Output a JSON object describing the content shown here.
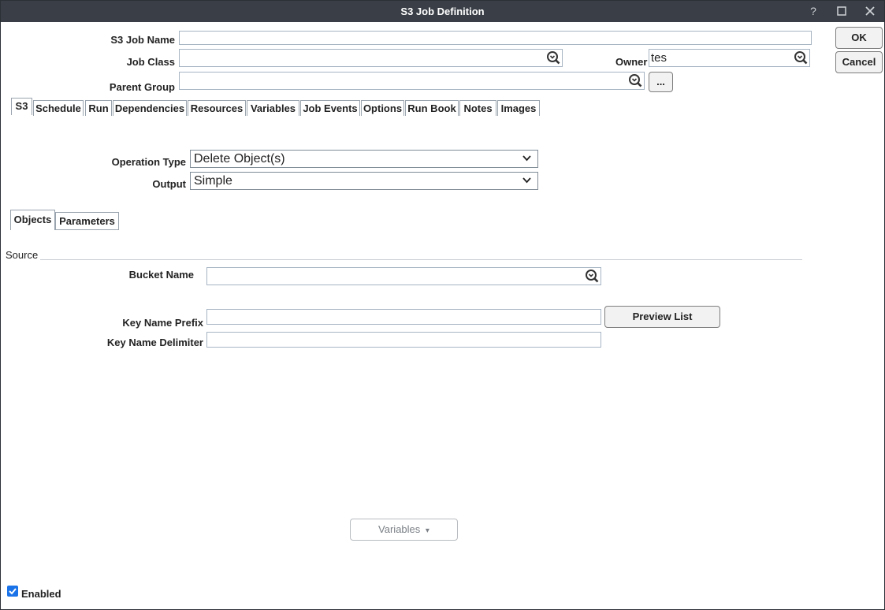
{
  "window": {
    "title": "S3 Job Definition",
    "help_label": "?"
  },
  "header": {
    "job_name_label": "S3 Job Name",
    "job_name_value": "",
    "job_class_label": "Job Class",
    "job_class_value": "",
    "owner_label": "Owner",
    "owner_value": "tes",
    "parent_group_label": "Parent Group",
    "parent_group_value": "",
    "browse_label": "..."
  },
  "actions": {
    "ok_label": "OK",
    "cancel_label": "Cancel"
  },
  "tabs": [
    {
      "label": "S3",
      "active": true
    },
    {
      "label": "Schedule"
    },
    {
      "label": "Run"
    },
    {
      "label": "Dependencies"
    },
    {
      "label": "Resources"
    },
    {
      "label": "Variables"
    },
    {
      "label": "Job Events"
    },
    {
      "label": "Options"
    },
    {
      "label": "Run Book"
    },
    {
      "label": "Notes"
    },
    {
      "label": "Images"
    }
  ],
  "s3": {
    "operation_type_label": "Operation Type",
    "operation_type_value": "Delete Object(s)",
    "output_label": "Output",
    "output_value": "Simple",
    "subtabs": [
      {
        "label": "Objects",
        "active": true
      },
      {
        "label": "Parameters"
      }
    ],
    "source_label": "Source",
    "bucket_name_label": "Bucket Name",
    "bucket_name_value": "",
    "key_prefix_label": "Key Name Prefix",
    "key_prefix_value": "",
    "preview_label": "Preview List",
    "key_delimiter_label": "Key Name Delimiter",
    "key_delimiter_value": "",
    "variables_label": "Variables",
    "variables_caret": "▾"
  },
  "footer": {
    "enabled_label": "Enabled",
    "enabled_checked": true
  },
  "colors": {
    "titlebar": "#3a3f47",
    "checkbox": "#1a73e8"
  }
}
